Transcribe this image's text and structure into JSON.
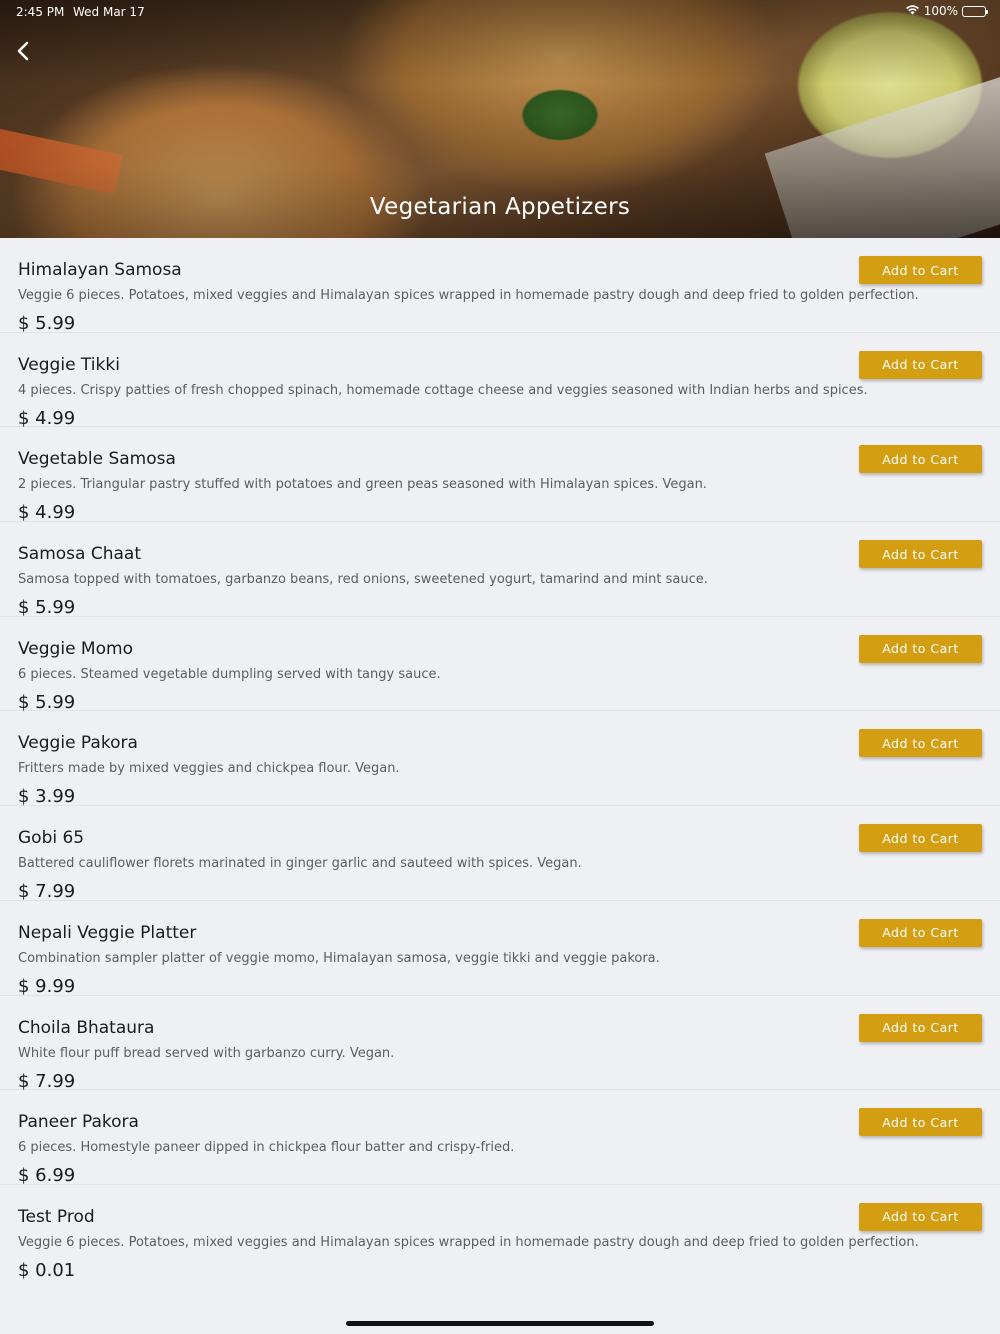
{
  "status_bar": {
    "time": "2:45 PM",
    "date": "Wed Mar 17",
    "battery": "100%",
    "icons": [
      "wifi-icon",
      "battery-icon"
    ]
  },
  "header": {
    "back_icon": "chevron-left-icon",
    "title": "Vegetarian Appetizers"
  },
  "menu": {
    "button_label": "Add to Cart",
    "accent_color": "#d39e11",
    "items": [
      {
        "name": "Himalayan Samosa",
        "description": "Veggie 6 pieces. Potatoes, mixed veggies and Himalayan spices wrapped in homemade pastry dough and deep fried to golden perfection.",
        "price": "$ 5.99"
      },
      {
        "name": "Veggie Tikki",
        "description": "4 pieces. Crispy patties of fresh chopped spinach, homemade cottage cheese and veggies seasoned with Indian herbs and spices.",
        "price": "$ 4.99"
      },
      {
        "name": "Vegetable Samosa",
        "description": "2 pieces. Triangular pastry stuffed with potatoes and green peas seasoned with Himalayan spices. Vegan.",
        "price": "$ 4.99"
      },
      {
        "name": "Samosa Chaat",
        "description": "Samosa topped with tomatoes, garbanzo beans, red onions, sweetened yogurt, tamarind and mint sauce.",
        "price": "$ 5.99"
      },
      {
        "name": "Veggie Momo",
        "description": "6 pieces. Steamed vegetable dumpling served with tangy sauce.",
        "price": "$ 5.99"
      },
      {
        "name": "Veggie Pakora",
        "description": "Fritters made by mixed veggies and chickpea flour. Vegan.",
        "price": "$ 3.99"
      },
      {
        "name": "Gobi 65",
        "description": "Battered cauliflower florets marinated in ginger garlic and sauteed with spices. Vegan.",
        "price": "$ 7.99"
      },
      {
        "name": "Nepali Veggie Platter",
        "description": "Combination sampler platter of veggie momo, Himalayan samosa, veggie tikki and veggie pakora.",
        "price": "$ 9.99"
      },
      {
        "name": "Choila Bhataura",
        "description": "White flour puff bread served with garbanzo curry. Vegan.",
        "price": "$ 7.99"
      },
      {
        "name": "Paneer Pakora",
        "description": "6 pieces. Homestyle paneer dipped in chickpea flour batter and crispy-fried.",
        "price": "$ 6.99"
      },
      {
        "name": "Test Prod",
        "description": "Veggie 6 pieces. Potatoes, mixed veggies and Himalayan spices wrapped in homemade pastry dough and deep fried to golden perfection.",
        "price": "$ 0.01"
      }
    ]
  }
}
